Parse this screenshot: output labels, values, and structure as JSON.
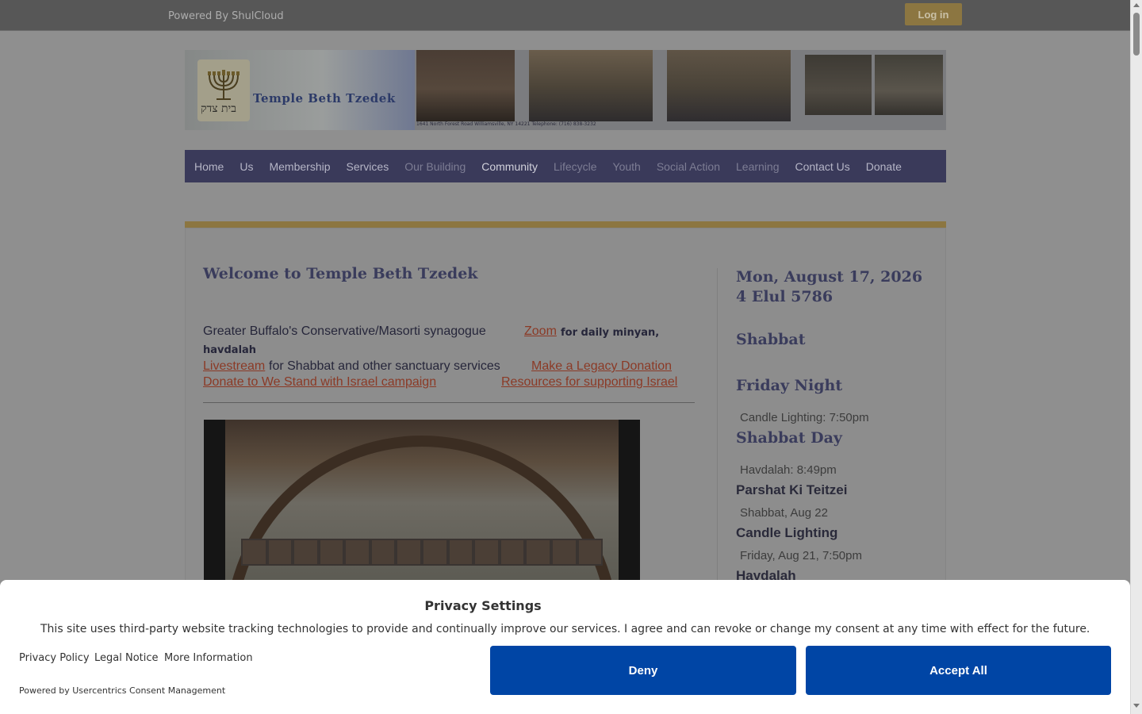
{
  "topbar": {
    "powered": "Powered By ShulCloud",
    "login": "Log in"
  },
  "banner": {
    "title": "Temple Beth Tzedek",
    "hebrew": "בית צדק",
    "address": "1641 North Forest Road Williamsville, NY 14221   Telephone: (716) 838-3232"
  },
  "nav": {
    "items": [
      "Home",
      "Us",
      "Membership",
      "Services",
      "Our Building",
      "Community",
      "Lifecycle",
      "Youth",
      "Social Action",
      "Learning",
      "Contact Us",
      "Donate"
    ]
  },
  "main": {
    "welcome": "Welcome to Temple Beth Tzedek",
    "intro": "Greater Buffalo's Conservative/Masorti synagogue",
    "zoom_link": "Zoom",
    "zoom_suffix": "for daily minyan,",
    "havdalah": "havdalah",
    "livestream_link": "Livestream",
    "livestream_suffix": "for Shabbat and other sanctuary services",
    "legacy_link": "Make a Legacy Donation",
    "israel_campaign_link": "Donate to We Stand with Israel campaign",
    "israel_resources_link": "Resources for supporting Israel"
  },
  "sidebar": {
    "date": "Mon, August 17, 2026",
    "hebrew_date": "4 Elul 5786",
    "shabbat": "Shabbat",
    "friday_night": "Friday Night",
    "candle_lighting": "Candle Lighting: 7:50pm",
    "shabbat_day": "Shabbat Day",
    "havdalah": "Havdalah: 8:49pm",
    "parshat": "Parshat Ki Teitzei",
    "parshat_date": "Shabbat, Aug 22",
    "candle_lighting_label": "Candle Lighting",
    "candle_lighting_date": "Friday, Aug 21, 7:50pm",
    "havdalah_label": "Havdalah"
  },
  "consent": {
    "title": "Privacy Settings",
    "text": "This site uses third-party website tracking technologies to provide and continually improve our services. I agree and can revoke or change my consent at any time with effect for the future.",
    "privacy_policy": "Privacy Policy",
    "legal_notice": "Legal Notice",
    "more_info": "More Information",
    "powered": "Powered by Usercentrics Consent Management",
    "deny": "Deny",
    "accept": "Accept All"
  },
  "colors": {
    "accent_gold": "#c9a54e",
    "nav_bg": "#5b5b8f",
    "link": "#c0392b",
    "button": "#0045a5"
  }
}
